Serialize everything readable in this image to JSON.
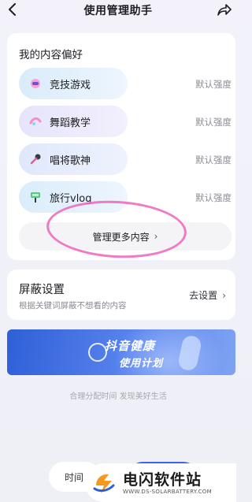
{
  "header": {
    "title": "使用管理助手",
    "back_icon": "chevron-left-icon",
    "share_icon": "share-arrow-icon"
  },
  "interests": {
    "title": "我的内容偏好",
    "items": [
      {
        "label": "竞技游戏",
        "strength": "默认强度",
        "icon": "game-icon",
        "pill_color": "#e3f0fb"
      },
      {
        "label": "舞蹈教学",
        "strength": "默认强度",
        "icon": "dance-icon",
        "pill_color": "#ece9fb"
      },
      {
        "label": "唱将歌神",
        "strength": "默认强度",
        "icon": "microphone-icon",
        "pill_color": "#e8edfb"
      },
      {
        "label": "旅行vlog",
        "strength": "默认强度",
        "icon": "travel-icon",
        "pill_color": "#e4f1fb"
      }
    ],
    "manage_more": "管理更多内容",
    "chevron": "›"
  },
  "block_settings": {
    "title": "屏蔽设置",
    "description": "根据关键词屏蔽不想看的内容",
    "action": "去设置",
    "chevron": "›"
  },
  "banner": {
    "line1": "抖音健康",
    "line2": "使用计划"
  },
  "footer": {
    "slogan": "合理分配时间 发现美好生活",
    "time_button": "时间"
  },
  "watermark": {
    "title": "电闪软件站",
    "url": "WWW.DS-SOLARBATTERY.COM"
  },
  "colors": {
    "accent": "#3c63f0",
    "annotation": "#f06bc0",
    "banner": "#2f5fd8"
  }
}
